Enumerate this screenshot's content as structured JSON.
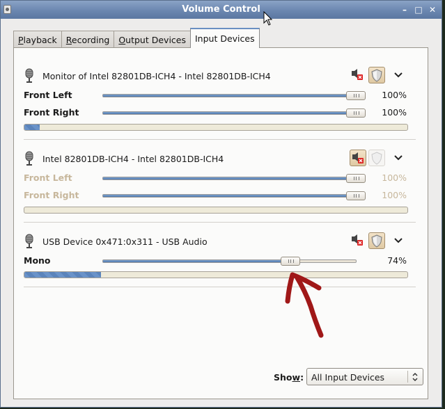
{
  "window": {
    "title": "Volume Control"
  },
  "tabs": [
    {
      "label": "Playback",
      "accel": "P",
      "rest": "layback"
    },
    {
      "label": "Recording",
      "accel": "R",
      "rest": "ecording"
    },
    {
      "label": "Output Devices",
      "accel": "O",
      "rest": "utput Devices"
    },
    {
      "label": "Input Devices",
      "accel": "",
      "rest": "Input Devices"
    }
  ],
  "devices": [
    {
      "name": "Monitor of Intel 82801DB-ICH4 - Intel 82801DB-ICH4",
      "muted": false,
      "locked": true,
      "channels": [
        {
          "label": "Front Left",
          "value": 100,
          "display": "100%"
        },
        {
          "label": "Front Right",
          "value": 100,
          "display": "100%"
        }
      ],
      "peak_level": 0.04
    },
    {
      "name": "Intel 82801DB-ICH4 - Intel 82801DB-ICH4",
      "muted": true,
      "locked": false,
      "channels": [
        {
          "label": "Front Left",
          "value": 100,
          "display": "100%"
        },
        {
          "label": "Front Right",
          "value": 100,
          "display": "100%"
        }
      ],
      "peak_level": 0.0
    },
    {
      "name": "USB Device 0x471:0x311 - USB Audio",
      "muted": false,
      "locked": true,
      "channels": [
        {
          "label": "Mono",
          "value": 74,
          "display": "74%"
        }
      ],
      "peak_level": 0.2
    }
  ],
  "footer": {
    "show_label": "Show:",
    "show_accel": "w",
    "show_prefix": "Sho",
    "show_suffix": ":",
    "filter_value": "All Input Devices"
  },
  "colors": {
    "accent": "#6a8fc2",
    "annotation": "#a01818",
    "slider_fill": "#4f78ac"
  },
  "icons": [
    "microphone-icon",
    "mute-icon",
    "lock-icon",
    "chevron-down-icon"
  ]
}
